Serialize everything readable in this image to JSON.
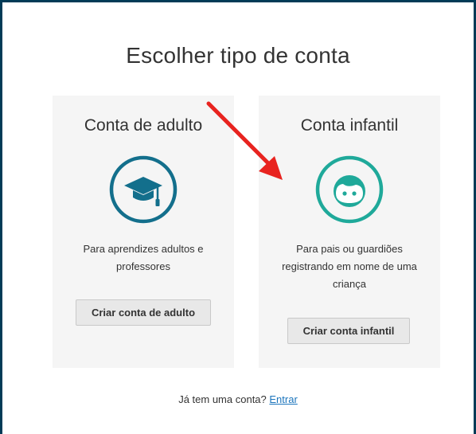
{
  "page": {
    "title": "Escolher tipo de conta"
  },
  "cards": {
    "adult": {
      "title": "Conta de adulto",
      "description": "Para aprendizes adultos e professores",
      "button_label": "Criar conta de adulto",
      "icon": "graduation-cap-icon",
      "color": "#136f8c"
    },
    "child": {
      "title": "Conta infantil",
      "description": "Para pais ou guardiões registrando em nome de uma criança",
      "button_label": "Criar conta infantil",
      "icon": "child-face-icon",
      "color": "#1fa99a"
    }
  },
  "footer": {
    "prompt": "Já tem uma conta?",
    "link_label": "Entrar",
    "link_color": "#1c75bc"
  },
  "annotation": {
    "icon": "red-arrow-icon",
    "color": "#e8231f"
  },
  "theme": {
    "frame_border": "#003b57",
    "card_background": "#f5f5f5",
    "button_background": "#e8e8e8"
  }
}
